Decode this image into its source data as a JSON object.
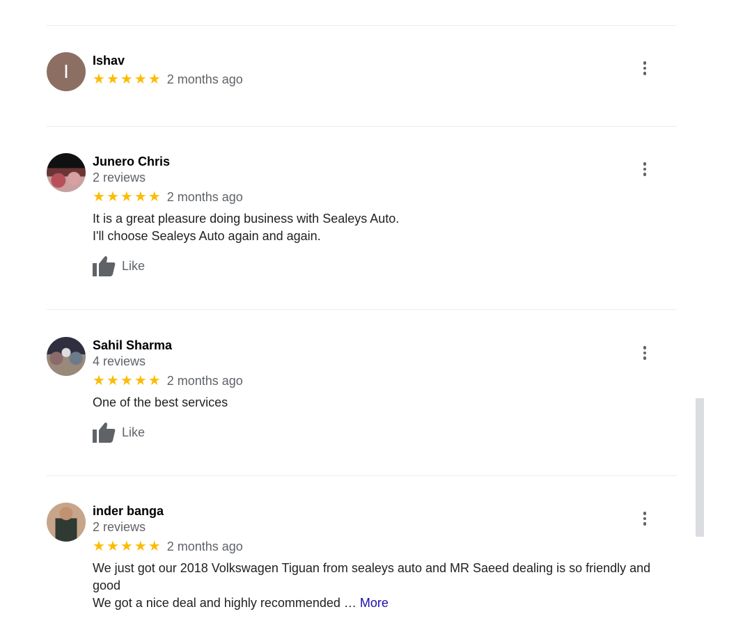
{
  "colors": {
    "star": "#fbbc04",
    "link": "#1a0dab",
    "scrollbar": "#dadce0",
    "avatar_letter_bg": "#8d6e63"
  },
  "reviews": [
    {
      "avatar_letter": "I",
      "name": "Ishav",
      "review_count": "",
      "rating": 5,
      "time": "2 months ago",
      "lines": [],
      "like_label": "",
      "more_label": ""
    },
    {
      "name": "Junero Chris",
      "review_count": "2 reviews",
      "rating": 5,
      "time": "2 months ago",
      "lines": [
        "It is a great pleasure doing business with Sealeys Auto.",
        "I'll choose Sealeys Auto again and again."
      ],
      "like_label": "Like"
    },
    {
      "name": "Sahil Sharma",
      "review_count": "4 reviews",
      "rating": 5,
      "time": "2 months ago",
      "lines": [
        "One of the best services"
      ],
      "like_label": "Like"
    },
    {
      "name": "inder banga",
      "review_count": "2 reviews",
      "rating": 5,
      "time": "2 months ago",
      "lines": [
        "We just got our 2018 Volkswagen Tiguan from sealeys auto and MR Saeed dealing is so friendly and good",
        "We got a nice deal and highly recommended …"
      ],
      "more_label": "More"
    }
  ]
}
